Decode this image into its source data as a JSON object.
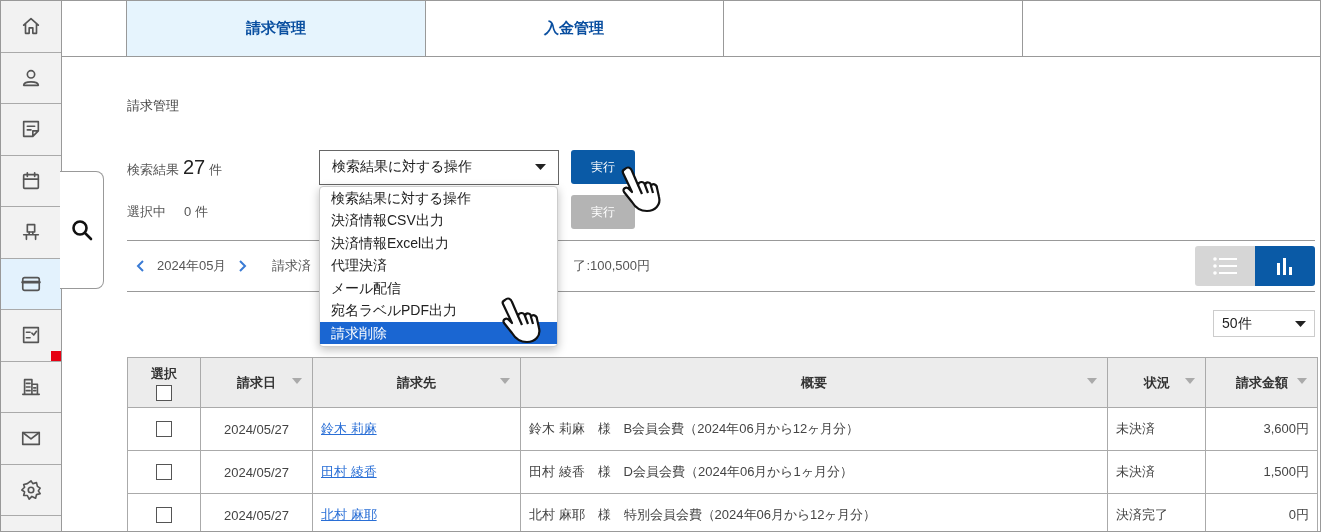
{
  "sidebar": {
    "items": [
      {
        "kind": "home",
        "selected": false,
        "badge": false
      },
      {
        "kind": "person",
        "selected": false,
        "badge": false
      },
      {
        "kind": "note",
        "selected": false,
        "badge": false
      },
      {
        "kind": "calendar",
        "selected": false,
        "badge": false
      },
      {
        "kind": "seat",
        "selected": false,
        "badge": false
      },
      {
        "kind": "card",
        "selected": true,
        "badge": false
      },
      {
        "kind": "checklist",
        "selected": false,
        "badge": true
      },
      {
        "kind": "building",
        "selected": false,
        "badge": false
      },
      {
        "kind": "mail",
        "selected": false,
        "badge": false
      },
      {
        "kind": "gear",
        "selected": false,
        "badge": false
      }
    ]
  },
  "tabs": [
    {
      "label": "請求管理",
      "selected": true
    },
    {
      "label": "入金管理",
      "selected": false
    }
  ],
  "page_title": "請求管理",
  "search_result": {
    "label": "検索結果",
    "count": "27",
    "unit": "件"
  },
  "bulk_action": {
    "value": "検索結果に対する操作",
    "button": "実行",
    "options": [
      {
        "label": "検索結果に対する操作",
        "highlighted": false
      },
      {
        "label": "決済情報CSV出力",
        "highlighted": false
      },
      {
        "label": "決済情報Excel出力",
        "highlighted": false
      },
      {
        "label": "代理決済",
        "highlighted": false
      },
      {
        "label": "メール配信",
        "highlighted": false
      },
      {
        "label": "宛名ラベルPDF出力",
        "highlighted": false
      },
      {
        "label": "請求削除",
        "highlighted": true
      }
    ]
  },
  "selection": {
    "label": "選択中",
    "count": "0 件",
    "button": "実行",
    "button_disabled": true
  },
  "period": {
    "month": "2024年05月",
    "summary_left": "請求済",
    "summary_right": "了:100,500円"
  },
  "view_toggle": [
    {
      "kind": "list",
      "selected": false
    },
    {
      "kind": "chart",
      "selected": true
    }
  ],
  "page_size": "50件",
  "table": {
    "columns": [
      {
        "label": "選択",
        "sortable": false
      },
      {
        "label": "請求日",
        "sortable": true
      },
      {
        "label": "請求先",
        "sortable": true
      },
      {
        "label": "概要",
        "sortable": true
      },
      {
        "label": "状況",
        "sortable": true
      },
      {
        "label": "請求金額",
        "sortable": true
      }
    ],
    "select_all_checked": false,
    "rows": [
      {
        "checked": false,
        "date": "2024/05/27",
        "recipient": "鈴木 莉麻",
        "summary": "鈴木 莉麻　様　B会員会費（2024年06月から12ヶ月分）",
        "status": "未決済",
        "amount": "3,600円"
      },
      {
        "checked": false,
        "date": "2024/05/27",
        "recipient": "田村 綾香",
        "summary": "田村 綾香　様　D会員会費（2024年06月から1ヶ月分）",
        "status": "未決済",
        "amount": "1,500円"
      },
      {
        "checked": false,
        "date": "2024/05/27",
        "recipient": "北村 麻耶",
        "summary": "北村 麻耶　様　特別会員会費（2024年06月から12ヶ月分）",
        "status": "決済完了",
        "amount": "0円"
      }
    ]
  }
}
